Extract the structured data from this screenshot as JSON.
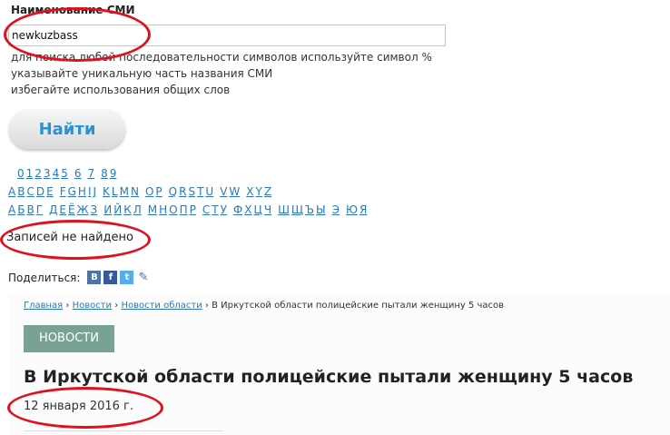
{
  "search": {
    "label": "Наименование СМИ",
    "value": "newkuzbass",
    "hints": [
      "для поиска любой последовательности символов используйте символ %",
      "указывайте уникальную часть названия СМИ",
      "избегайте использования общих слов"
    ],
    "button_label": "Найти"
  },
  "alphabet": {
    "digits": [
      "0",
      "1",
      "2",
      "3",
      "4",
      "5",
      "6",
      "7",
      "8",
      "9"
    ],
    "latin": [
      "A",
      "B",
      "C",
      "D",
      "E",
      "F",
      "G",
      "H",
      "I",
      "J",
      "K",
      "L",
      "M",
      "N",
      "O",
      "P",
      "Q",
      "R",
      "S",
      "T",
      "U",
      "V",
      "W",
      "X",
      "Y",
      "Z"
    ],
    "cyrillic": [
      "А",
      "Б",
      "В",
      "Г",
      "Д",
      "Е",
      "Ё",
      "Ж",
      "З",
      "И",
      "Й",
      "К",
      "Л",
      "М",
      "Н",
      "О",
      "П",
      "Р",
      "С",
      "Т",
      "У",
      "Ф",
      "Х",
      "Ц",
      "Ч",
      "Ш",
      "Щ",
      "Ъ",
      "Ы",
      "Э",
      "Ю",
      "Я"
    ]
  },
  "result_text": "Записей не найдено",
  "share": {
    "label": "Поделиться:",
    "icons": [
      "vk-icon",
      "facebook-icon",
      "twitter-icon",
      "livejournal-icon"
    ]
  },
  "article": {
    "breadcrumb": {
      "home": "Главная",
      "news": "Новости",
      "region_news": "Новости области",
      "separator": "›",
      "current": "В Иркутской области полицейские пытали женщину 5 часов"
    },
    "category": "НОВОСТИ",
    "title": "В Иркутской области полицейские пытали женщину 5 часов",
    "date": "12 января 2016 г."
  },
  "colors": {
    "link": "#2a7ab8",
    "button_text": "#2a93d5",
    "badge": "#78a394",
    "annotation": "#e0101e"
  }
}
